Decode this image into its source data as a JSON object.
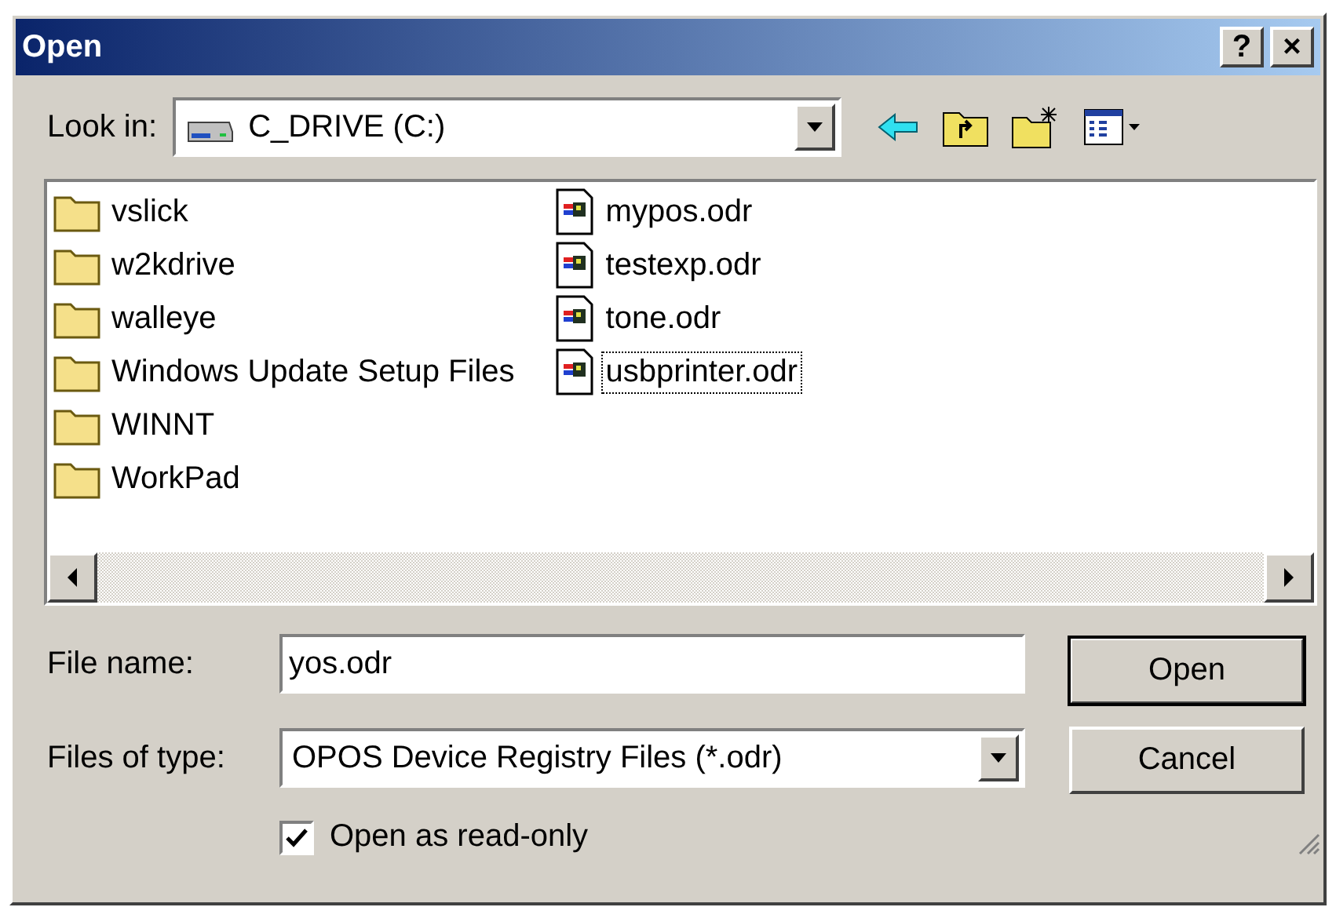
{
  "window": {
    "title": "Open",
    "buttons": [
      "?",
      "×"
    ]
  },
  "look_in": {
    "label": "Look in:",
    "value": "C_DRIVE (C:)"
  },
  "files": [
    {
      "name": "vslick",
      "kind": "folder",
      "focused": false
    },
    {
      "name": "w2kdrive",
      "kind": "folder",
      "focused": false
    },
    {
      "name": "walleye",
      "kind": "folder",
      "focused": false
    },
    {
      "name": "Windows Update Setup Files",
      "kind": "folder",
      "focused": false
    },
    {
      "name": "WINNT",
      "kind": "folder",
      "focused": false
    },
    {
      "name": "WorkPad",
      "kind": "folder",
      "focused": false
    },
    {
      "name": "mypos.odr",
      "kind": "document",
      "focused": false
    },
    {
      "name": "testexp.odr",
      "kind": "document",
      "focused": false
    },
    {
      "name": "tone.odr",
      "kind": "document",
      "focused": false
    },
    {
      "name": "usbprinter.odr",
      "kind": "document",
      "focused": true
    }
  ],
  "file_name": {
    "label": "File name:",
    "value": "yos.odr"
  },
  "files_of_type": {
    "label": "Files of type:",
    "value": "OPOS Device Registry Files (*.odr)"
  },
  "read_only": {
    "label": "Open as read-only",
    "checked": true
  },
  "buttons": [
    {
      "label": "Open",
      "default": true
    },
    {
      "label": "Cancel",
      "default": false
    }
  ]
}
